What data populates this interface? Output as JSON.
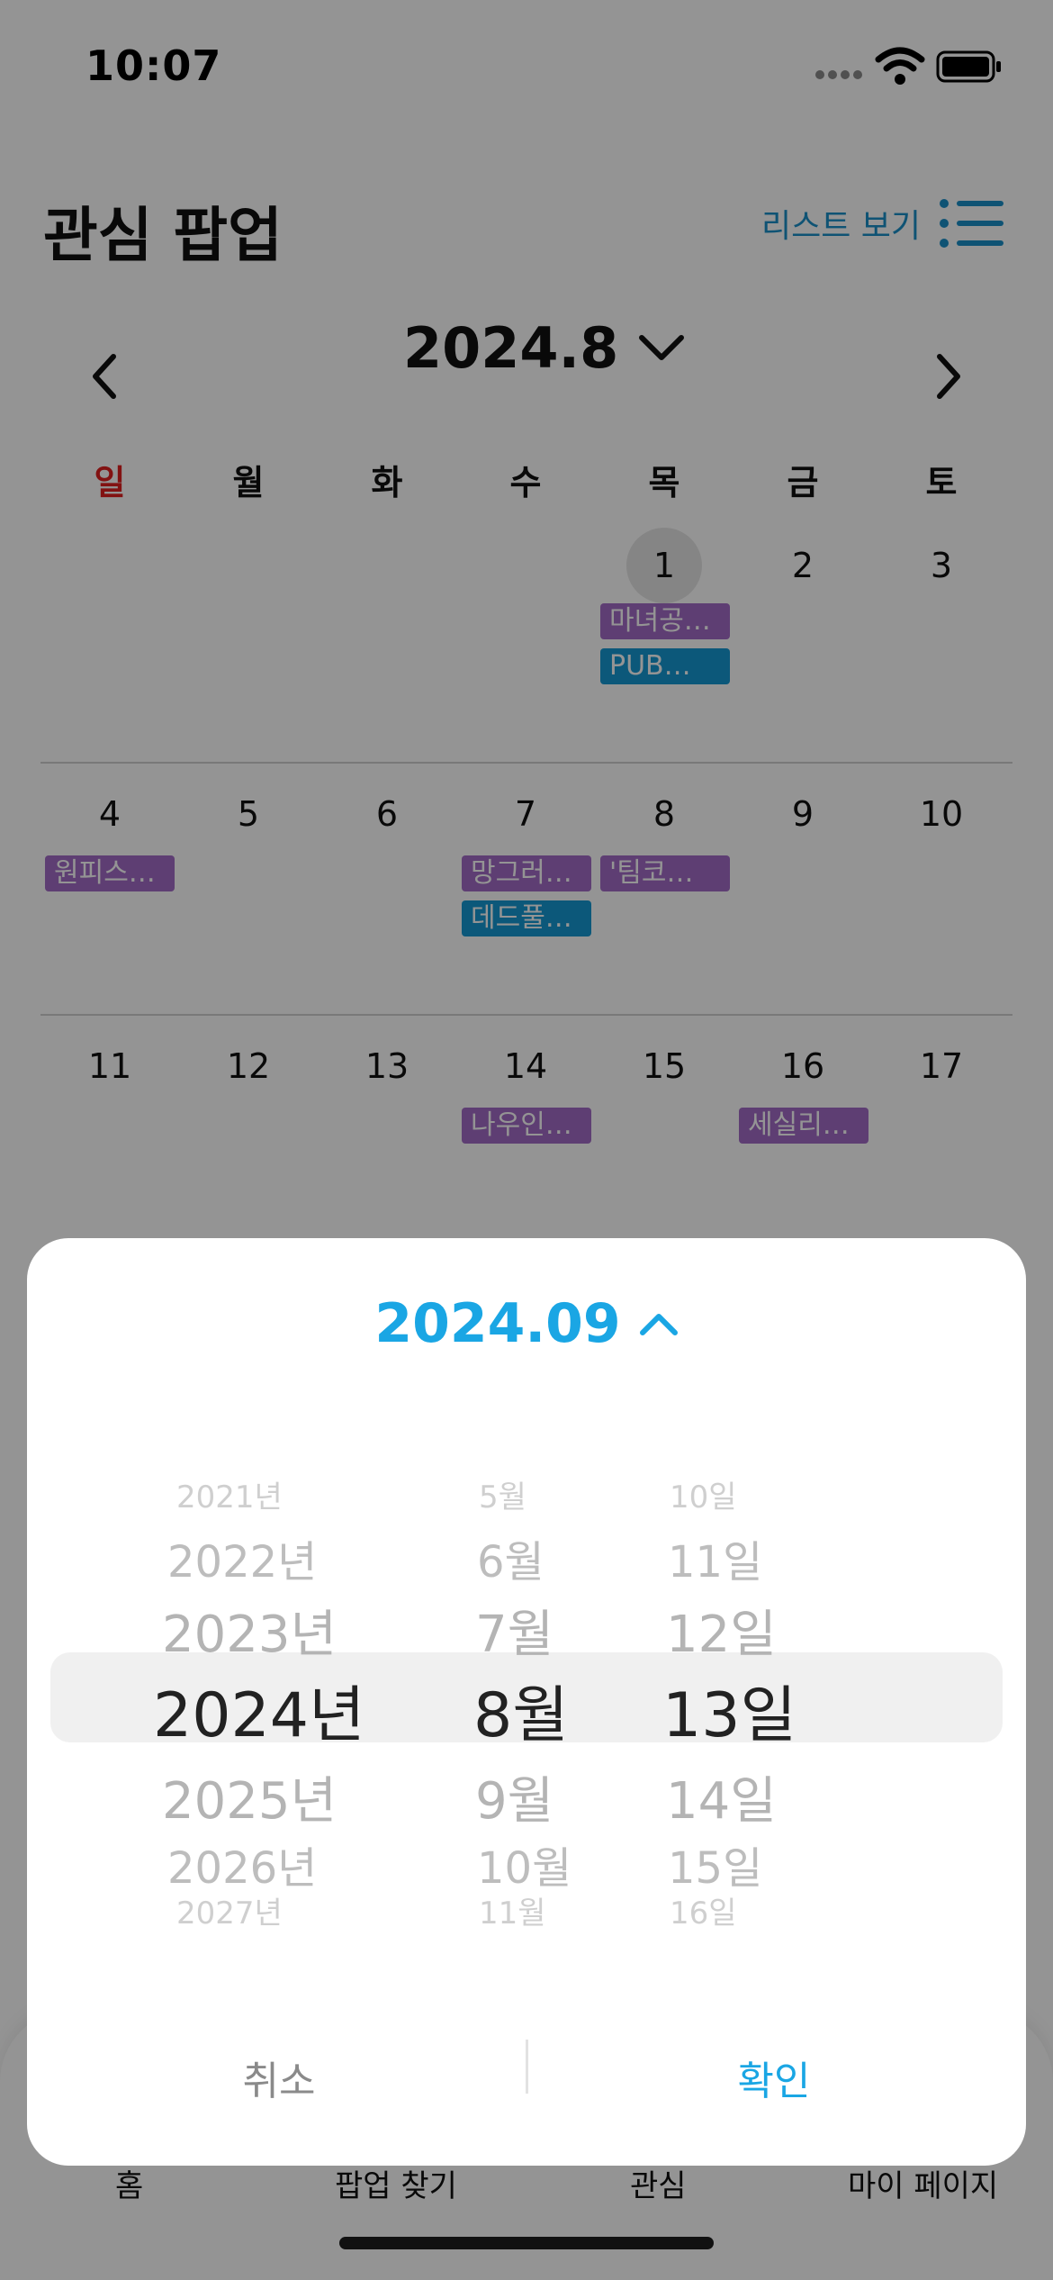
{
  "status_bar": {
    "time": "10:07"
  },
  "header": {
    "title": "관심 팝업",
    "list_view_label": "리스트 보기"
  },
  "calendar": {
    "month_label": "2024.8",
    "weekdays": [
      "일",
      "월",
      "화",
      "수",
      "목",
      "금",
      "토"
    ],
    "weeks": [
      {
        "days": [
          "",
          "",
          "",
          "",
          "1",
          "2",
          "3"
        ]
      },
      {
        "days": [
          "4",
          "5",
          "6",
          "7",
          "8",
          "9",
          "10"
        ]
      },
      {
        "days": [
          "11",
          "12",
          "13",
          "14",
          "15",
          "16",
          "17"
        ]
      }
    ],
    "events": [
      {
        "label": "마녀공…",
        "color": "#a36bc6"
      },
      {
        "label": "PUB…",
        "color": "#1598d2"
      },
      {
        "label": "원피스…",
        "color": "#a36bc6"
      },
      {
        "label": "망그러…",
        "color": "#a36bc6"
      },
      {
        "label": "데드풀…",
        "color": "#1598d2"
      },
      {
        "label": "'팀코…",
        "color": "#a36bc6"
      },
      {
        "label": "나우인…",
        "color": "#a36bc6"
      },
      {
        "label": "세실리…",
        "color": "#a36bc6"
      }
    ]
  },
  "tab_bar": {
    "home": "홈",
    "find_popup": "팝업 찾기",
    "favorites": "관심",
    "my_page": "마이 페이지"
  },
  "date_picker": {
    "title": "2024.09",
    "years": [
      "2021년",
      "2022년",
      "2023년",
      "2024년",
      "2025년",
      "2026년",
      "2027년"
    ],
    "months": [
      "5월",
      "6월",
      "7월",
      "8월",
      "9월",
      "10월",
      "11월"
    ],
    "days": [
      "10일",
      "11일",
      "12일",
      "13일",
      "14일",
      "15일",
      "16일"
    ],
    "cancel_label": "취소",
    "confirm_label": "확인"
  },
  "colors": {
    "accent": "#1aa6e4",
    "sunday": "#e02020",
    "event_purple": "#a36bc6",
    "event_blue": "#1598d2"
  }
}
